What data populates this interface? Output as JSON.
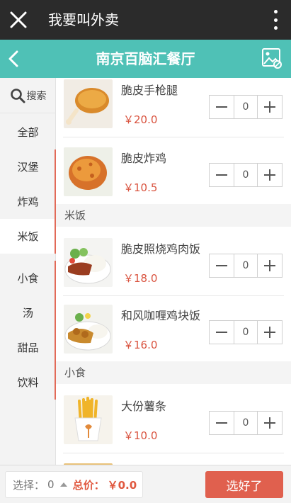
{
  "wechat": {
    "title": "我要叫外卖"
  },
  "header": {
    "title": "南京百脑汇餐厅"
  },
  "sidebar": {
    "search_label": "搜索",
    "categories": [
      {
        "label": "全部",
        "active": false
      },
      {
        "label": "汉堡",
        "active": false
      },
      {
        "label": "炸鸡",
        "active": false
      },
      {
        "label": "米饭",
        "active": true
      },
      {
        "label": "小食",
        "active": false
      },
      {
        "label": "汤",
        "active": false
      },
      {
        "label": "甜品",
        "active": false
      },
      {
        "label": "饮料",
        "active": false
      }
    ]
  },
  "content": {
    "items": [
      {
        "name": "脆皮手枪腿",
        "price": "￥20.0",
        "qty": "0"
      },
      {
        "name": "脆皮炸鸡",
        "price": "￥10.5",
        "qty": "0"
      },
      {
        "name": "脆皮照烧鸡肉饭",
        "price": "￥18.0",
        "qty": "0"
      },
      {
        "name": "和风咖喱鸡块饭",
        "price": "￥16.0",
        "qty": "0"
      },
      {
        "name": "大份薯条",
        "price": "￥10.0",
        "qty": "0"
      }
    ],
    "sections": [
      {
        "title": "米饭"
      },
      {
        "title": "小食"
      }
    ]
  },
  "bottom": {
    "selected_label": "选择：",
    "selected_value": "0",
    "total_label": "总价：",
    "total_value": "￥0.0",
    "submit_label": "选好了"
  },
  "colors": {
    "wechat_bar": "#2b2b2b",
    "header": "#4fc1b6",
    "price": "#d9533f",
    "accent": "#e0604e"
  }
}
